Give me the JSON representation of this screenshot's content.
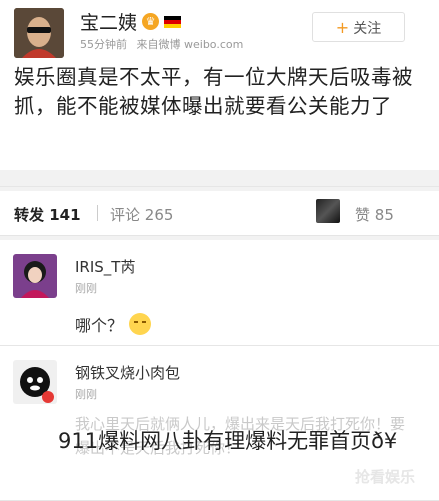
{
  "post": {
    "username": "宝二姨",
    "badge_icon": "crown-badge-icon",
    "flag_icon": "germany-flag-icon",
    "time": "55分钟前",
    "source": "来自微博 weibo.com",
    "follow_label": "关注",
    "content": "娱乐圈真是不太平，有一位大牌天后吸毒被抓，能不能被媒体曝出就要看公关能力了"
  },
  "tabs": {
    "repost_label": "转发",
    "repost_count": "141",
    "comment_label": "评论",
    "comment_count": "265",
    "like_label": "赞",
    "like_count": "85"
  },
  "comments": [
    {
      "name": "IRIS_T芮",
      "time": "刚刚",
      "text": "哪个？",
      "emoji": "sick-face-emoji"
    },
    {
      "name": "钢铁叉烧小肉包",
      "time": "刚刚",
      "text": "我心里天后就俩人儿，爆出来是天后我打死你！要爆出不是天后我打死你！"
    }
  ],
  "overlay": {
    "caption": "911爆料网八卦有理爆料无罪首页ð¥",
    "watermark": "抢看娱乐"
  },
  "colors": {
    "accent_orange": "#f39a22",
    "background": "#f2f2f2"
  }
}
